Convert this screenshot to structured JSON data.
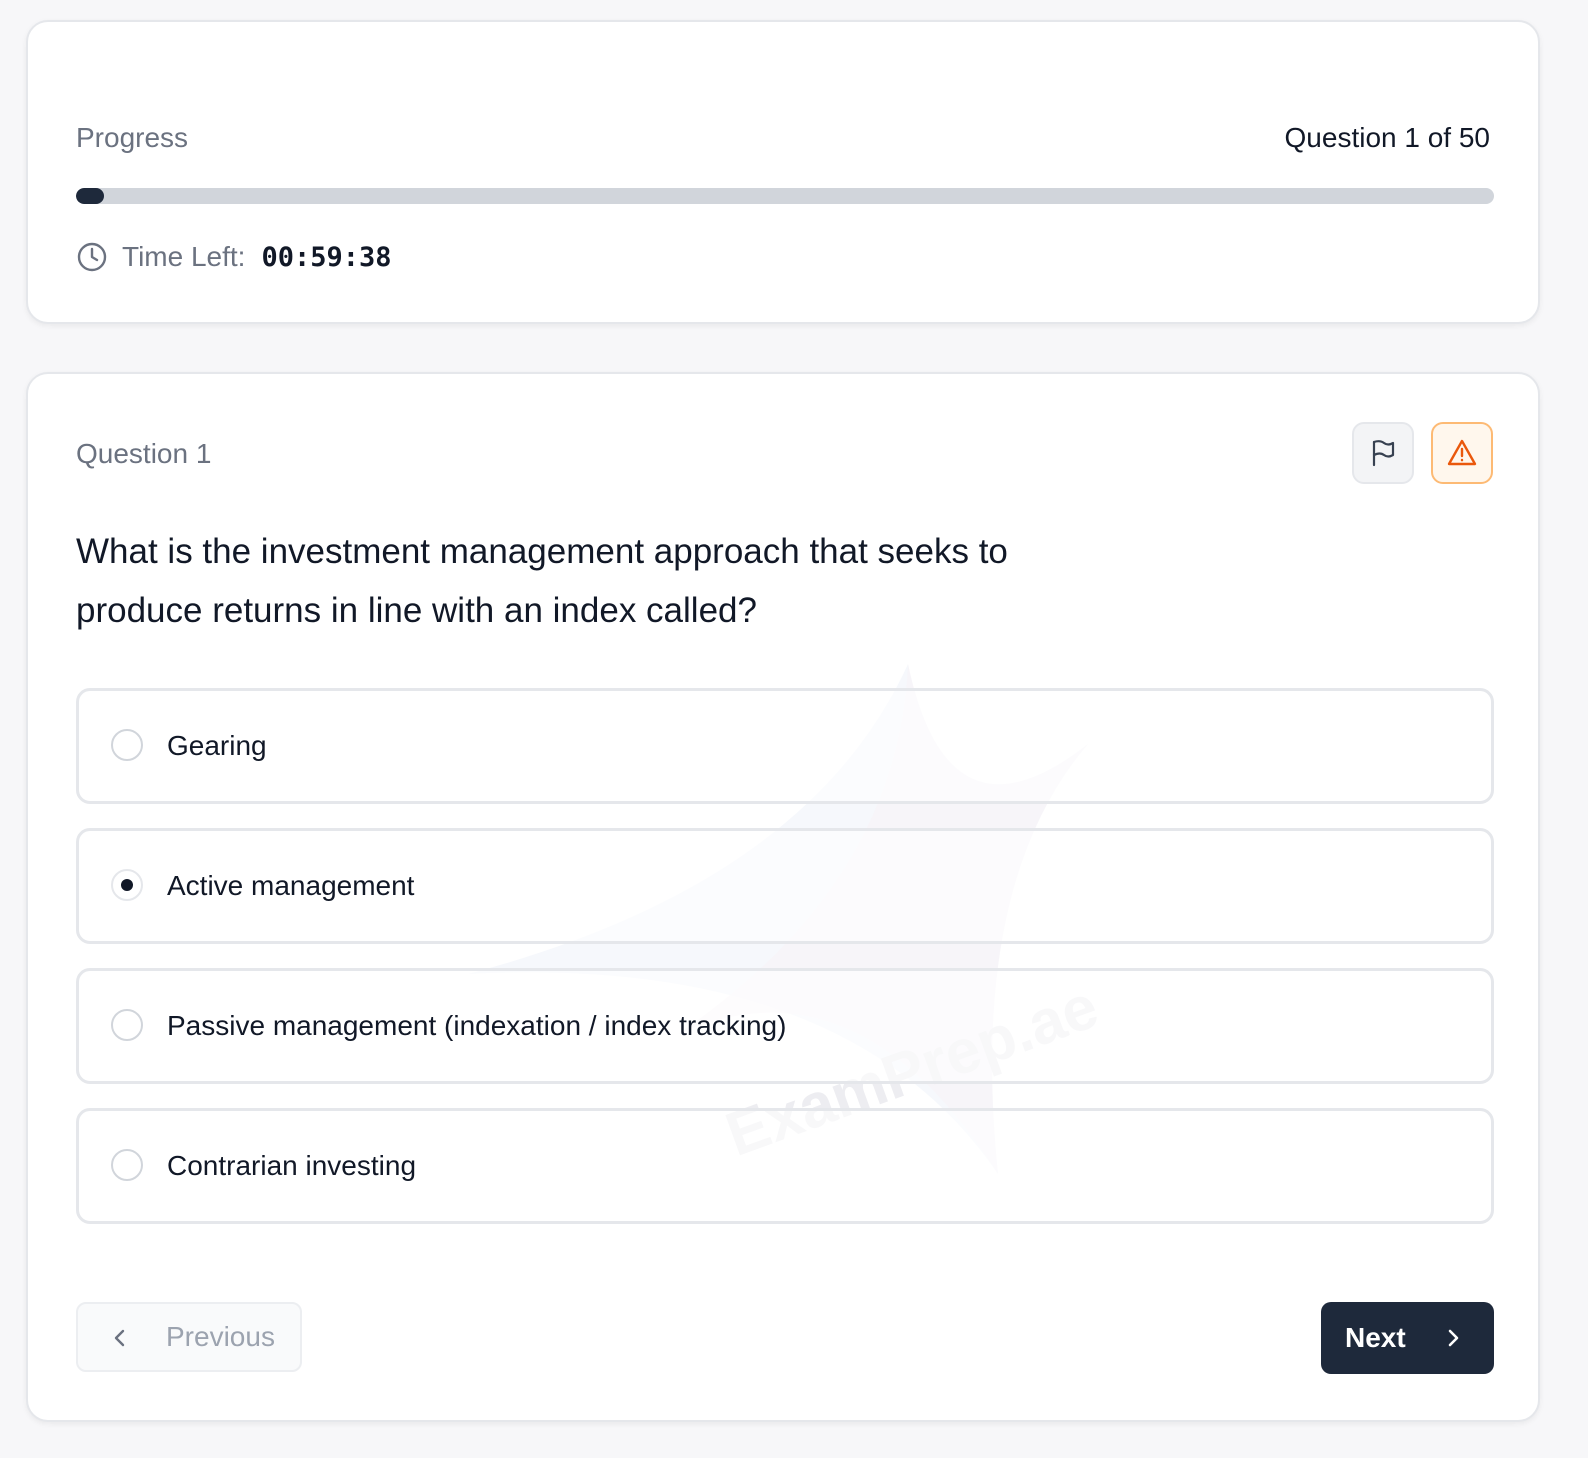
{
  "progress": {
    "label": "Progress",
    "count": "Question 1 of 50",
    "current": 1,
    "total": 50
  },
  "timer": {
    "label": "Time Left:",
    "value": "00:59:38"
  },
  "question": {
    "label": "Question 1",
    "text": "What is the investment management approach that seeks to produce returns in line with an index called?",
    "options": [
      {
        "label": "Gearing",
        "selected": false
      },
      {
        "label": "Active management",
        "selected": true
      },
      {
        "label": "Passive management (indexation / index tracking)",
        "selected": false
      },
      {
        "label": "Contrarian investing",
        "selected": false
      }
    ]
  },
  "actions": {
    "flag_icon": "flag-icon",
    "report_icon": "alert-triangle-icon"
  },
  "navigation": {
    "previous_label": "Previous",
    "next_label": "Next"
  },
  "watermark": "ExamPrep.ae",
  "colors": {
    "primary": "#1e293b",
    "progress_track": "#d1d5db",
    "report_accent": "#ea580c",
    "report_bg": "#fff7ed"
  }
}
